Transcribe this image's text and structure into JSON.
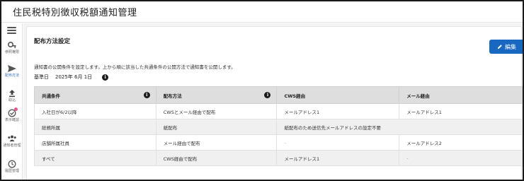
{
  "app": {
    "title": "住民税特別徴収税額通知管理"
  },
  "sidebar": {
    "items": [
      {
        "id": "reference",
        "label": "参照権限",
        "icon": "key-icon"
      },
      {
        "id": "distribution",
        "label": "配布方法",
        "icon": "send-icon",
        "active": true
      },
      {
        "id": "import",
        "label": "取込",
        "icon": "upload-icon"
      },
      {
        "id": "confirm",
        "label": "表示確認",
        "icon": "check-circle-icon",
        "badge": true
      },
      {
        "id": "recipients",
        "label": "通知者管理",
        "icon": "people-icon"
      },
      {
        "id": "history",
        "label": "履歴管理",
        "icon": "history-icon"
      }
    ]
  },
  "section": {
    "title": "配布方法設定",
    "edit_label": "編集",
    "description": "通知書の公開条件を設定します。上から順に該当した共通条件の公開方法で通知書を公開します。",
    "ref_date_label": "基準日",
    "ref_date_value": "2025年 6月 1日"
  },
  "table": {
    "headers": [
      "共通条件",
      "配布方法",
      "CWS経由",
      "メール経由"
    ],
    "rows": [
      [
        "入社日が6/2以降",
        "CWSとメール経由で配布",
        "メールアドレス1",
        "メールアドレス1"
      ],
      [
        "総務所属",
        "紙配布",
        "紙配布のため送信先メールアドレスの設定不要"
      ],
      [
        "店舗所属社員",
        "メール経由で配布",
        "-",
        "メールアドレス2"
      ],
      [
        "すべて",
        "CWS経由で配布",
        "メールアドレス1",
        "-"
      ]
    ]
  },
  "colors": {
    "accent": "#1867c0",
    "badge": "#e55a8e"
  }
}
